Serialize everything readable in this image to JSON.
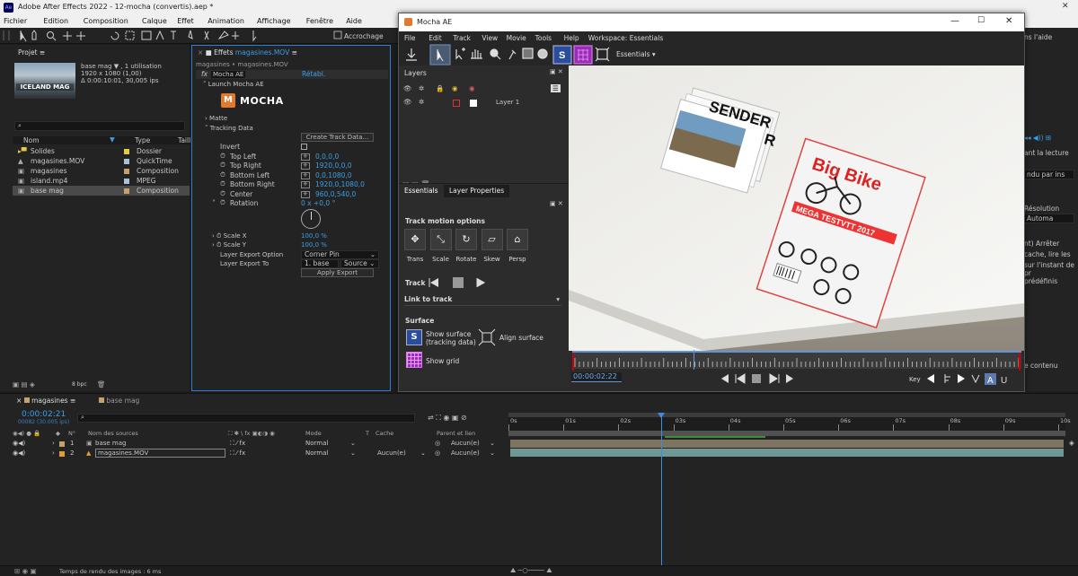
{
  "window": {
    "title": "Adobe After Effects 2022 - 12-mocha (convertis).aep *",
    "app_badge": "Ae"
  },
  "menu": [
    "Fichier",
    "Edition",
    "Composition",
    "Calque",
    "Effet",
    "Animation",
    "Affichage",
    "Fenêtre",
    "Aide"
  ],
  "toolbar": {
    "snap_label": "Accrochage"
  },
  "project": {
    "tab": "Projet",
    "thumb_text": "ICELAND MAG",
    "info_name": "base mag ▼ , 1 utilisation",
    "info_size": "1920 x 1080 (1,00)",
    "info_duration": "Δ 0:00:10:01, 30,005 ips",
    "col_name": "Nom",
    "col_type": "Type",
    "col_extra": "Taill",
    "items": [
      {
        "name": "Solides",
        "type": "Dossier",
        "color": "#e6c94a"
      },
      {
        "name": "magasines.MOV",
        "type": "QuickTime",
        "color": "#a4c4d8"
      },
      {
        "name": "magasines",
        "type": "Composition",
        "color": "#c5a16b"
      },
      {
        "name": "island.mp4",
        "type": "MPEG",
        "color": "#a4c4d8"
      },
      {
        "name": "base mag",
        "type": "Composition",
        "color": "#c5a16b"
      }
    ],
    "footer_bpc": "8 bpc"
  },
  "effects": {
    "tab_label": "Effets",
    "tab_target": "magasines.MOV",
    "breadcrumb": "magasines • magasines.MOV",
    "fx_name": "Mocha AE",
    "reset": "Rétabl.",
    "launch": "Launch Mocha AE",
    "logo": "MOCHA",
    "matte": "Matte",
    "tracking_data": "Tracking Data",
    "create_button": "Create Track Data...",
    "rows": [
      {
        "label": "Invert",
        "value": ""
      },
      {
        "label": "Top Left",
        "value": "0,0,0,0"
      },
      {
        "label": "Top Right",
        "value": "1920,0,0,0"
      },
      {
        "label": "Bottom Left",
        "value": "0,0,1080,0"
      },
      {
        "label": "Bottom Right",
        "value": "1920,0,1080,0"
      },
      {
        "label": "Center",
        "value": "960,0,540,0"
      },
      {
        "label": "Rotation",
        "value": "0 x +0,0 °"
      }
    ],
    "scale_x_label": "Scale X",
    "scale_x": "100,0 %",
    "scale_y_label": "Scale Y",
    "scale_y": "100,0 %",
    "layer_export_option_label": "Layer Export Option",
    "layer_export_option": "Corner Pin",
    "layer_export_to_label": "Layer Export To",
    "layer_export_to": "1. base m",
    "layer_export_source": "Source",
    "apply_export": "Apply Export"
  },
  "mocha": {
    "title": "Mocha AE",
    "menu": [
      "File",
      "Edit",
      "Track",
      "View",
      "Movie",
      "Tools",
      "Help",
      "Workspace: Essentials"
    ],
    "workspace": "Essentials",
    "layers_title": "Layers",
    "layer_name": "Layer 1",
    "tabs": [
      "Essentials",
      "Layer Properties"
    ],
    "track_motion_title": "Track motion options",
    "motion_options": [
      "Trans",
      "Scale",
      "Rotate",
      "Skew",
      "Persp"
    ],
    "track_label": "Track",
    "link_to_track": "Link to track",
    "surface_title": "Surface",
    "show_surface": "Show surface",
    "show_surface_sub": "(tracking data)",
    "align_surface": "Align surface",
    "show_grid": "Show grid",
    "timecode": "00:00:02:22",
    "key_label": "Key",
    "playhead_fraction": 0.27
  },
  "photo": {
    "magazine_top": "SENDER",
    "magazine_mid": "R",
    "magazine_main": "Big Bike",
    "headline": "MEGA TESTVTT 2017"
  },
  "right_panel": {
    "items": [
      "ns l'aide",
      "ant la lecture",
      "ndu par ins",
      "Résolution",
      "Automa",
      "nt) Arrêter",
      "cache, lire les",
      "sur l'instant de pr",
      "prédéfinis",
      "e contenu"
    ]
  },
  "timeline": {
    "tab_active": "magasines",
    "tab_other": "base mag",
    "timecode": "0:00:02:21",
    "frames": "00082 (30.005 ips)",
    "col_name": "Nom des sources",
    "col_mode": "Mode",
    "col_t": "T",
    "col_cache": "Cache",
    "col_parent": "Parent et lien",
    "layers": [
      {
        "num": "1",
        "name": "base mag",
        "mode": "Normal",
        "cache": "",
        "parent": "Aucun(e)",
        "color": "#c5a16b"
      },
      {
        "num": "2",
        "name": "magasines.MOV",
        "mode": "Normal",
        "cache": "Aucun(e)",
        "parent": "Aucun(e)",
        "color": "#e39a3b"
      }
    ],
    "ruler": [
      "0s",
      "01s",
      "02s",
      "03s",
      "04s",
      "05s",
      "06s",
      "07s",
      "08s",
      "09s",
      "10s"
    ],
    "playhead_fraction": 0.274
  },
  "status": {
    "render_time": "Temps de rendu des images :  6 ms"
  }
}
